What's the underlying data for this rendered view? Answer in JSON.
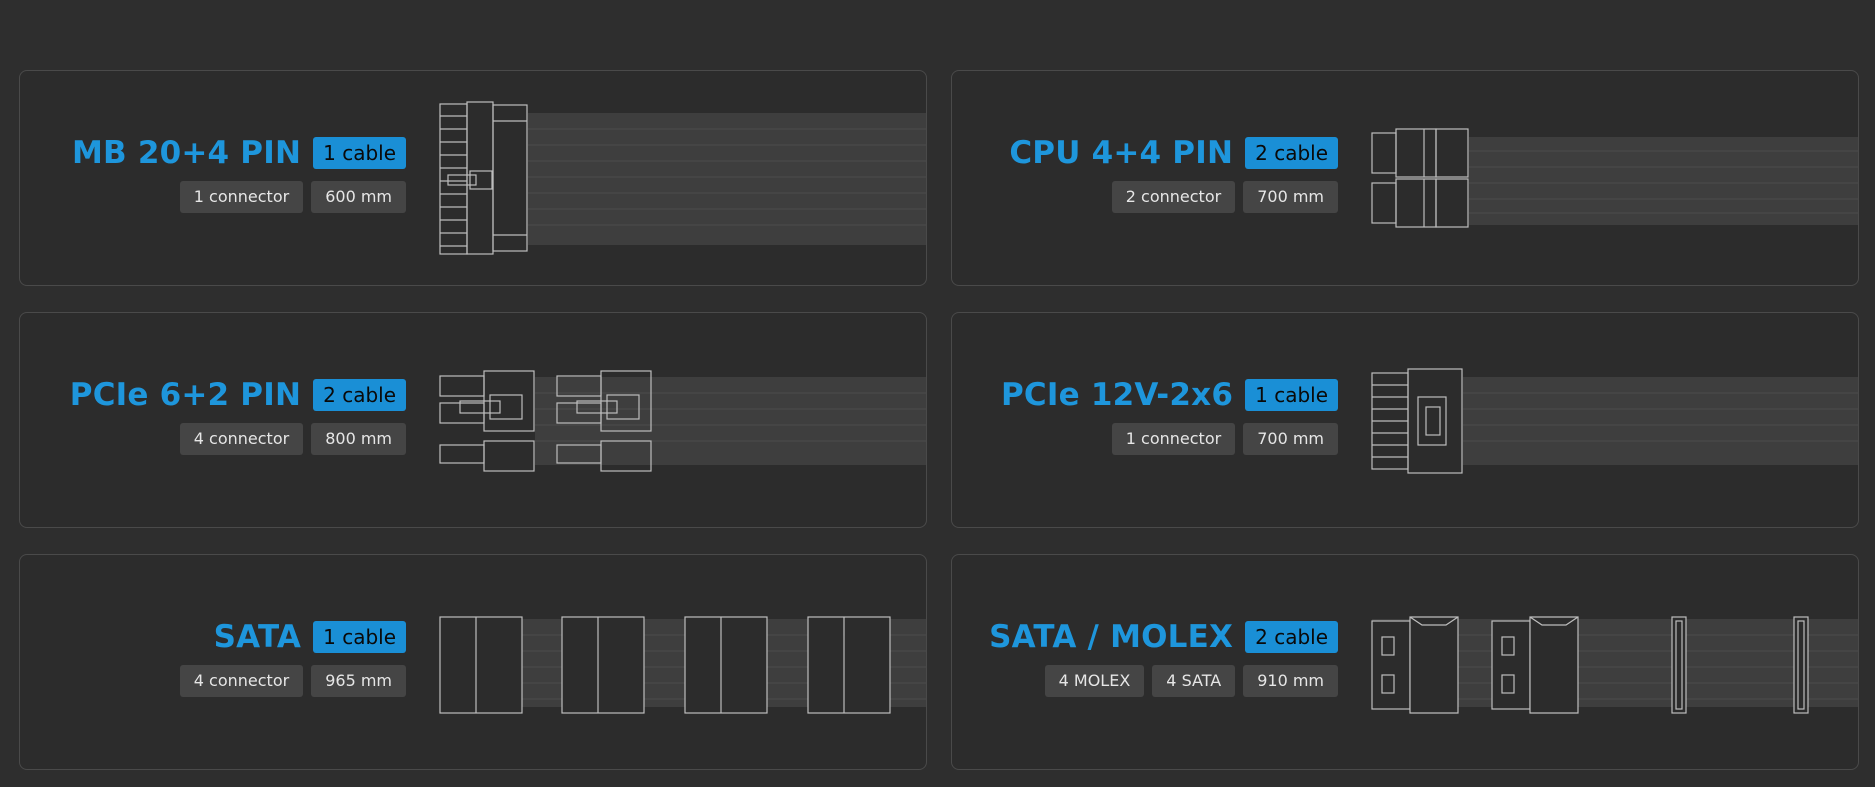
{
  "cards": [
    {
      "title": "MB 20+4 PIN",
      "badge": "1 cable",
      "tags": [
        "1 connector",
        "600 mm"
      ]
    },
    {
      "title": "CPU 4+4 PIN",
      "badge": "2 cable",
      "tags": [
        "2 connector",
        "700 mm"
      ]
    },
    {
      "title": "PCIe 6+2 PIN",
      "badge": "2 cable",
      "tags": [
        "4 connector",
        "800 mm"
      ]
    },
    {
      "title": "PCIe 12V-2x6",
      "badge": "1 cable",
      "tags": [
        "1 connector",
        "700 mm"
      ]
    },
    {
      "title": "SATA",
      "badge": "1 cable",
      "tags": [
        "4 connector",
        "965 mm"
      ]
    },
    {
      "title": "SATA / MOLEX",
      "badge": "2 cable",
      "tags": [
        "4 MOLEX",
        "4 SATA",
        "910 mm"
      ]
    }
  ],
  "colors": {
    "accent": "#1a8fd6",
    "title": "#1e96dc",
    "background": "#2e2e2e",
    "tag_bg": "#454545"
  },
  "icons": [
    "mb-24pin-connector-icon",
    "cpu-8pin-connector-icon",
    "pcie-8pin-connector-icon",
    "pcie-12v-2x6-connector-icon",
    "sata-connector-icon",
    "molex-sata-connector-icon"
  ]
}
